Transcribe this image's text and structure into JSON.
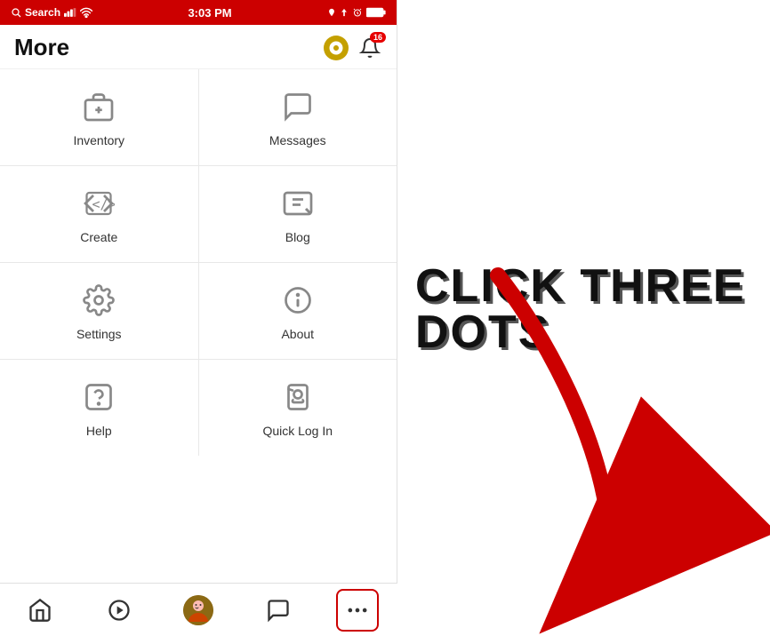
{
  "statusBar": {
    "left": "Search",
    "time": "3:03 PM",
    "battery": "100%"
  },
  "header": {
    "title": "More",
    "robuxIcon": "R$",
    "notifCount": "16"
  },
  "menuItems": [
    {
      "id": "inventory",
      "label": "Inventory",
      "icon": "inventory"
    },
    {
      "id": "messages",
      "label": "Messages",
      "icon": "messages"
    },
    {
      "id": "create",
      "label": "Create",
      "icon": "create"
    },
    {
      "id": "blog",
      "label": "Blog",
      "icon": "blog"
    },
    {
      "id": "settings",
      "label": "Settings",
      "icon": "settings"
    },
    {
      "id": "about",
      "label": "About",
      "icon": "about"
    },
    {
      "id": "help",
      "label": "Help",
      "icon": "help"
    },
    {
      "id": "quicklogin",
      "label": "Quick Log In",
      "icon": "quicklogin"
    }
  ],
  "bottomNav": [
    {
      "id": "home",
      "icon": "home",
      "label": "Home"
    },
    {
      "id": "play",
      "icon": "play",
      "label": "Play"
    },
    {
      "id": "avatar",
      "icon": "avatar",
      "label": "Avatar"
    },
    {
      "id": "chat",
      "icon": "chat",
      "label": "Chat"
    },
    {
      "id": "more",
      "icon": "more",
      "label": "More",
      "active": true
    }
  ],
  "annotation": {
    "line1": "CLICK THREE",
    "line2": "DOTS"
  }
}
